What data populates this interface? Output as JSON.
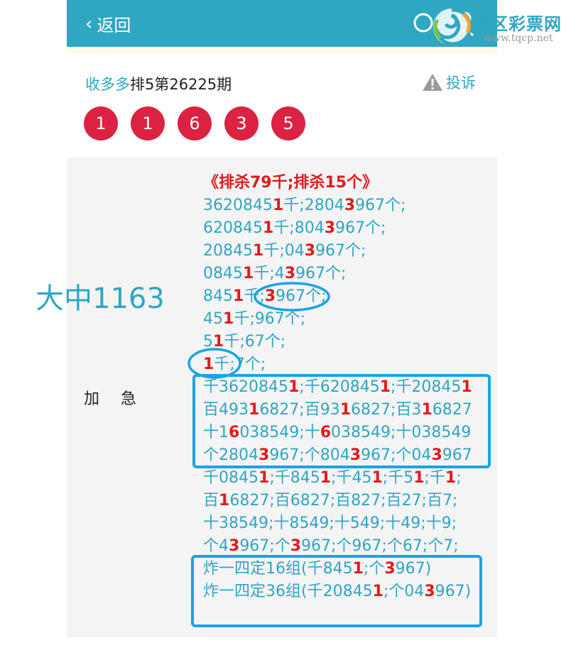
{
  "nav": {
    "back_label": "返回"
  },
  "logo": {
    "brand": "特区彩票网",
    "url": "www.tqcp.net"
  },
  "header": {
    "source": "收多多",
    "title": "排5第26225期",
    "report_label": "投诉"
  },
  "balls": [
    "1",
    "1",
    "6",
    "3",
    "5"
  ],
  "row": {
    "label": "加急"
  },
  "note": "大中1163",
  "content": {
    "heading": "《排杀79千;排杀15个》",
    "lines": [
      [
        [
          "3620845",
          0
        ],
        [
          "1",
          1
        ],
        [
          "千;2804",
          0
        ],
        [
          "3",
          1
        ],
        [
          "967个;",
          0
        ]
      ],
      [
        [
          "620845",
          0
        ],
        [
          "1",
          1
        ],
        [
          "千;804",
          0
        ],
        [
          "3",
          1
        ],
        [
          "967个;",
          0
        ]
      ],
      [
        [
          "20845",
          0
        ],
        [
          "1",
          1
        ],
        [
          "千;04",
          0
        ],
        [
          "3",
          1
        ],
        [
          "967个;",
          0
        ]
      ],
      [
        [
          "0845",
          0
        ],
        [
          "1",
          1
        ],
        [
          "千;4",
          0
        ],
        [
          "3",
          1
        ],
        [
          "967个;",
          0
        ]
      ],
      [
        [
          "845",
          0
        ],
        [
          "1",
          1
        ],
        [
          "千;",
          0
        ],
        [
          "3",
          1
        ],
        [
          "967个;",
          0
        ]
      ],
      [
        [
          "45",
          0
        ],
        [
          "1",
          1
        ],
        [
          "千;967个;",
          0
        ]
      ],
      [
        [
          "5",
          0
        ],
        [
          "1",
          1
        ],
        [
          "千;67个;",
          0
        ]
      ],
      [
        [
          "1",
          1
        ],
        [
          "千;7个;",
          0
        ]
      ],
      [
        [
          "千3620845",
          0
        ],
        [
          "1",
          1
        ],
        [
          ";千620845",
          0
        ],
        [
          "1",
          1
        ],
        [
          ";千20845",
          0
        ],
        [
          "1",
          1
        ]
      ],
      [
        [
          "百493",
          0
        ],
        [
          "1",
          1
        ],
        [
          "6827;百93",
          0
        ],
        [
          "1",
          1
        ],
        [
          "6827;百3",
          0
        ],
        [
          "1",
          1
        ],
        [
          "6827",
          0
        ]
      ],
      [
        [
          "十1",
          0
        ],
        [
          "6",
          1
        ],
        [
          "038549;十",
          0
        ],
        [
          "6",
          1
        ],
        [
          "038549;十038549",
          0
        ]
      ],
      [
        [
          "个2804",
          0
        ],
        [
          "3",
          1
        ],
        [
          "967;个804",
          0
        ],
        [
          "3",
          1
        ],
        [
          "967;个04",
          0
        ],
        [
          "3",
          1
        ],
        [
          "967",
          0
        ]
      ],
      [
        [
          "千0845",
          0
        ],
        [
          "1",
          1
        ],
        [
          ";千845",
          0
        ],
        [
          "1",
          1
        ],
        [
          ";千45",
          0
        ],
        [
          "1",
          1
        ],
        [
          ";千5",
          0
        ],
        [
          "1",
          1
        ],
        [
          ";千",
          0
        ],
        [
          "1",
          1
        ],
        [
          ";",
          0
        ]
      ],
      [
        [
          "百",
          0
        ],
        [
          "1",
          1
        ],
        [
          "6827;百6827;百827;百27;百7;",
          0
        ]
      ],
      [
        [
          "十38549;十8549;十549;十49;十9;",
          0
        ]
      ],
      [
        [
          "个4",
          0
        ],
        [
          "3",
          1
        ],
        [
          "967;个",
          0
        ],
        [
          "3",
          1
        ],
        [
          "967;个967;个67;个7;",
          0
        ]
      ],
      [
        [
          "炸一四定16组(千845",
          0
        ],
        [
          "1",
          1
        ],
        [
          ";个",
          0
        ],
        [
          "3",
          1
        ],
        [
          "967)",
          0
        ]
      ],
      [
        [
          "炸一四定36组(千20845",
          0
        ],
        [
          "1",
          1
        ],
        [
          ";个04",
          0
        ],
        [
          "3",
          1
        ],
        [
          "967)",
          0
        ]
      ]
    ]
  },
  "colors": {
    "accent": "#2fa6c2",
    "ball": "#dc2241",
    "highlight": "#e01b1b",
    "annotation": "#1aa3e8"
  }
}
